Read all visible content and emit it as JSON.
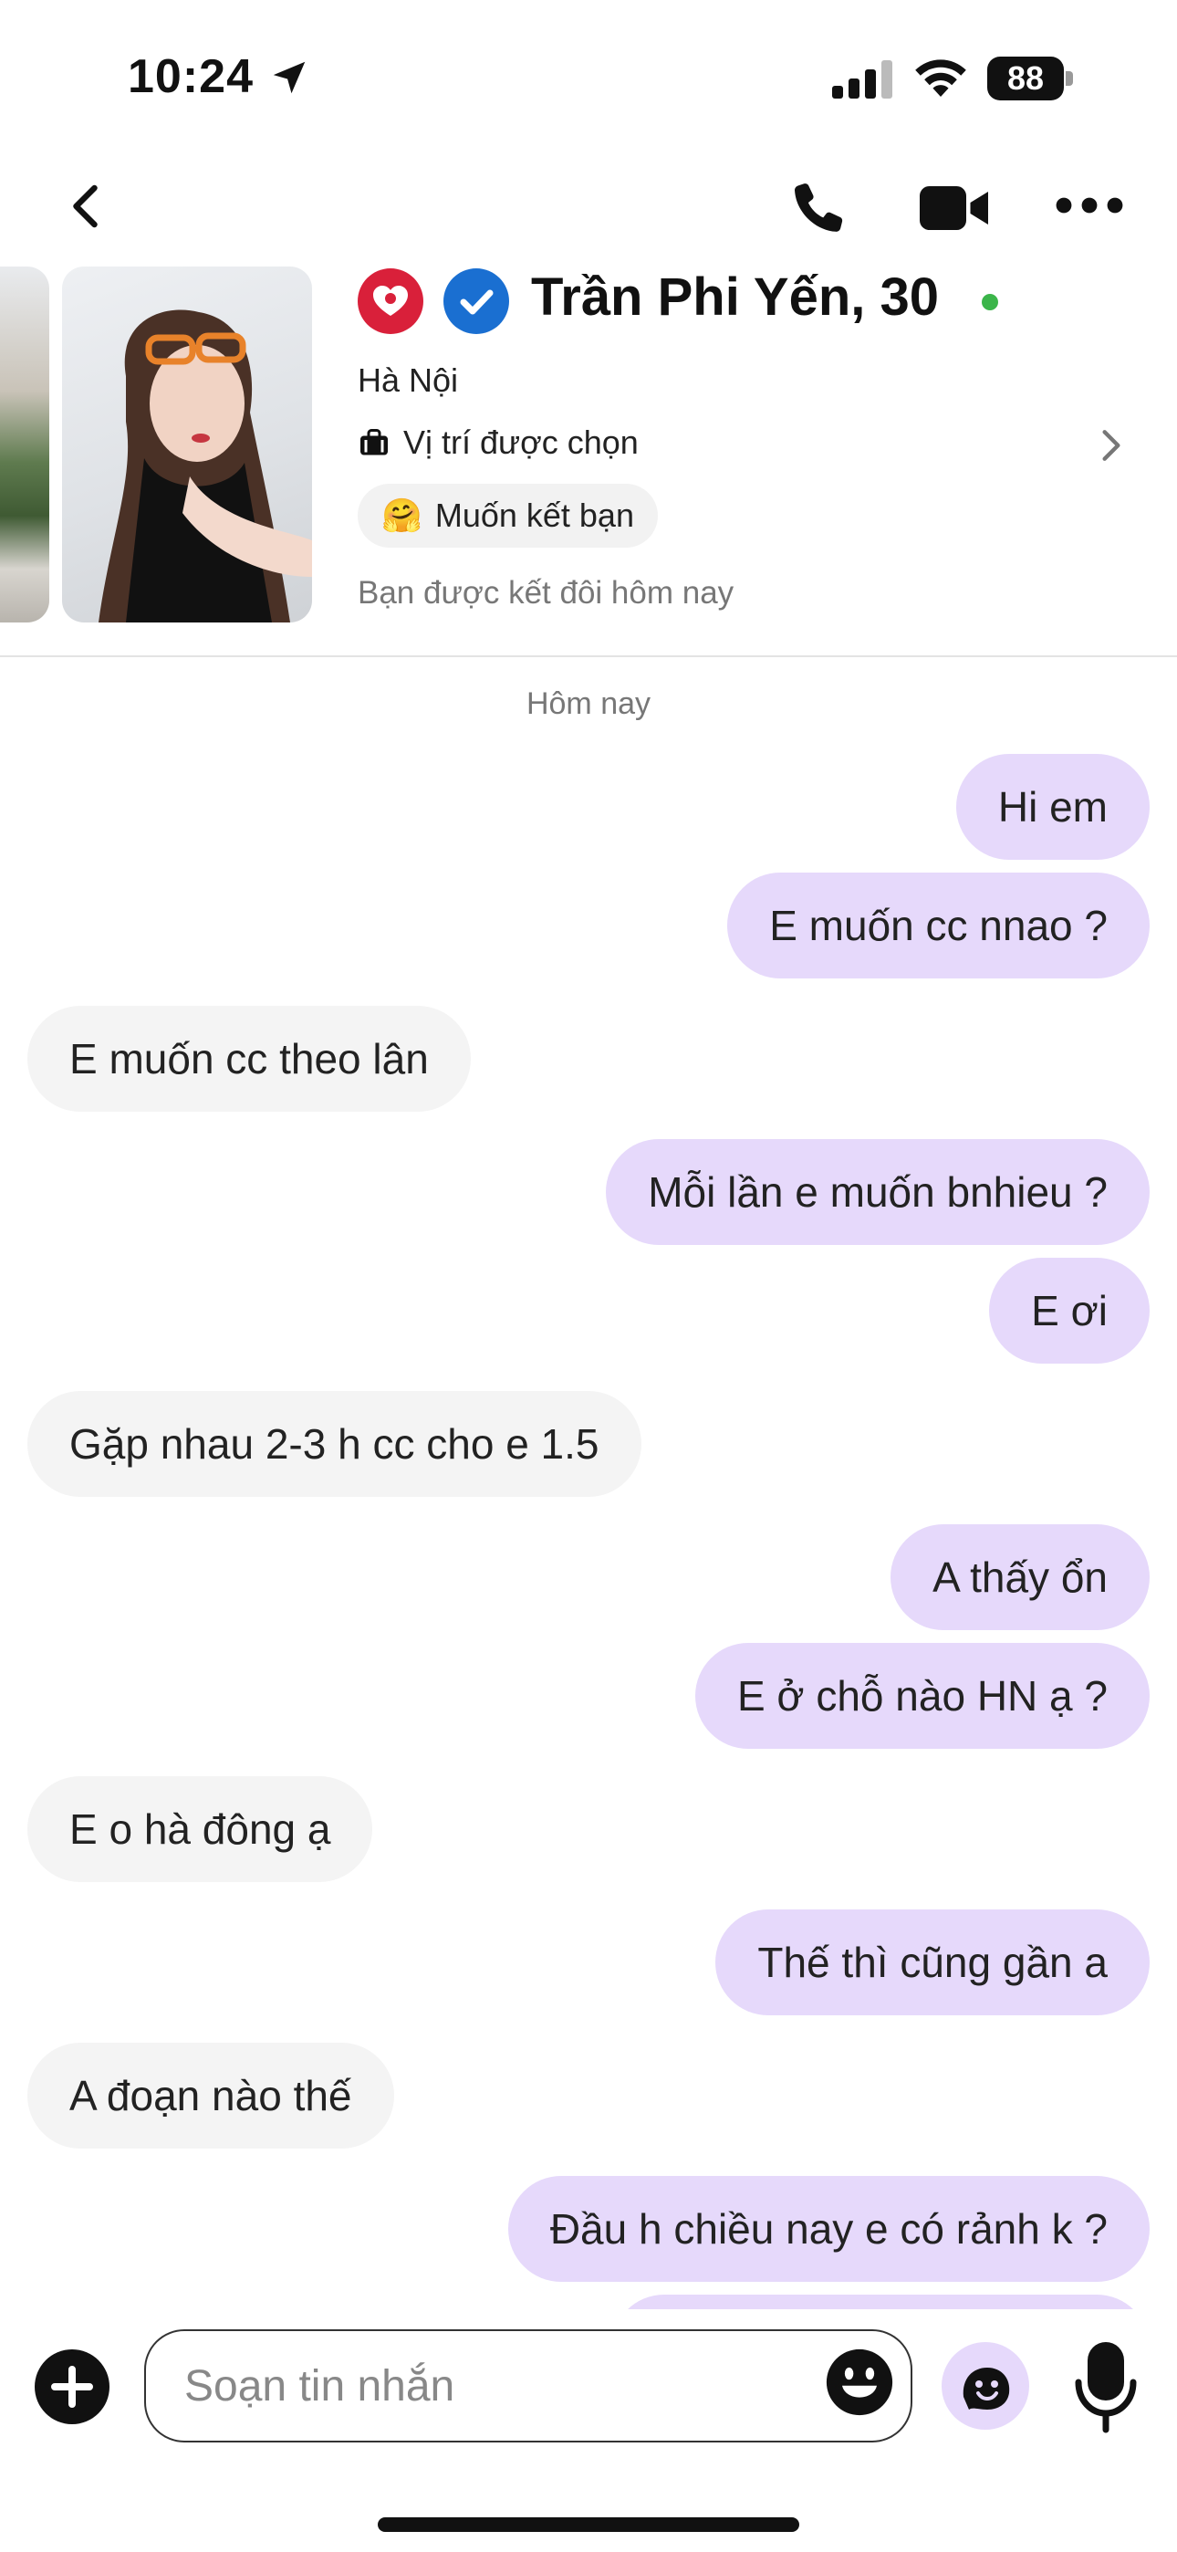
{
  "status_bar": {
    "time": "10:24",
    "battery": "88"
  },
  "profile": {
    "name": "Trần Phi Yến, 30",
    "city": "Hà Nội",
    "location_label": "Vị trí được chọn",
    "intent_emoji": "🤗",
    "intent_label": "Muốn kết bạn",
    "match_note": "Bạn được kết đôi hôm nay",
    "online": true
  },
  "chat": {
    "date_separator": "Hôm nay",
    "messages": [
      {
        "dir": "out",
        "text": "Hi em"
      },
      {
        "dir": "out",
        "text": "E muốn cc nnao ?"
      },
      {
        "dir": "in",
        "text": "E muốn cc theo lân"
      },
      {
        "dir": "out",
        "text": "Mỗi lần e muốn bnhieu ?"
      },
      {
        "dir": "out",
        "text": "E ơi"
      },
      {
        "dir": "in",
        "text": "Gặp nhau 2-3 h cc cho e 1.5"
      },
      {
        "dir": "out",
        "text": "A thấy ổn"
      },
      {
        "dir": "out",
        "text": "E ở chỗ nào HN ạ ?"
      },
      {
        "dir": "in",
        "text": "E o hà đông ạ"
      },
      {
        "dir": "out",
        "text": "Thế thì cũng gần a"
      },
      {
        "dir": "in",
        "text": "A đoạn nào thế"
      },
      {
        "dir": "out",
        "text": "Đầu h chiều nay e có rảnh k ?"
      }
    ]
  },
  "composer": {
    "placeholder": "Soạn tin nhắn"
  },
  "colors": {
    "outgoing_bubble": "#e6d9fb",
    "incoming_bubble": "#f4f4f4",
    "heart_badge": "#d9203a",
    "verified_badge": "#1a6fd1",
    "online": "#3bb54a"
  }
}
